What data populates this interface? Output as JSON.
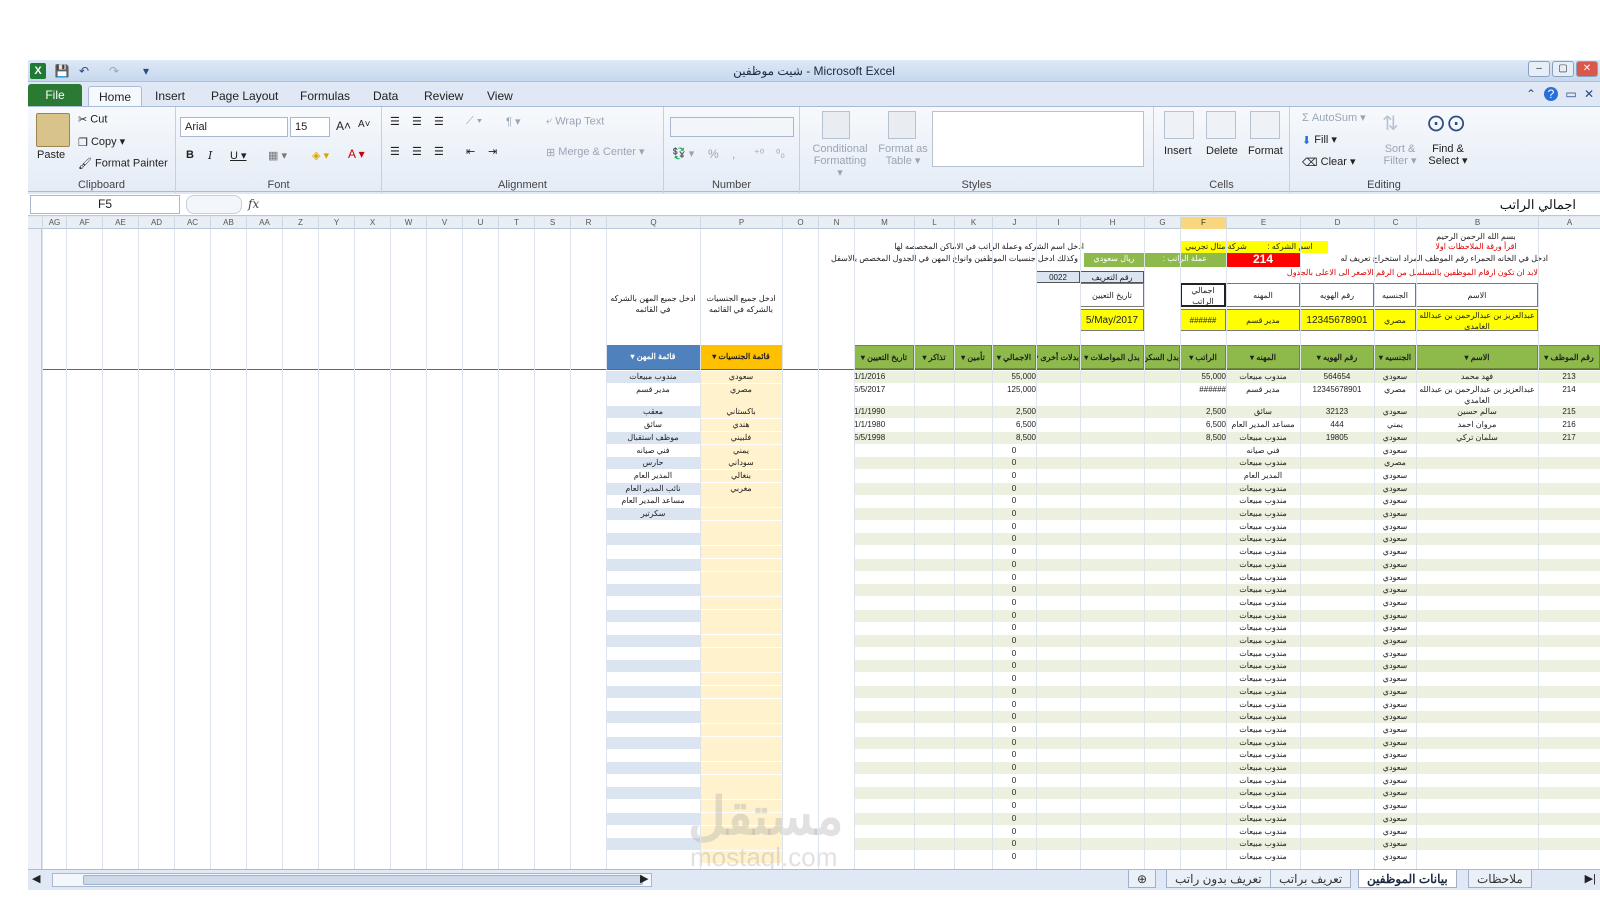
{
  "window": {
    "title": "شيت موظفين  -  Microsoft Excel"
  },
  "qat": {
    "save": "💾",
    "undo": "↶",
    "redo": "↷"
  },
  "tabs": [
    "File",
    "Home",
    "Insert",
    "Page Layout",
    "Formulas",
    "Data",
    "Review",
    "View"
  ],
  "clipboard": {
    "paste": "Paste",
    "cut": "Cut",
    "copy": "Copy ▾",
    "format_painter": "Format Painter",
    "label": "Clipboard"
  },
  "font": {
    "name": "Arial",
    "size": "15",
    "label": "Font"
  },
  "alignment": {
    "wrap": "Wrap Text",
    "merge": "Merge & Center ▾",
    "label": "Alignment"
  },
  "number": {
    "label": "Number",
    "percent": "%",
    "comma": ","
  },
  "styles": {
    "conditional": "Conditional Formatting ▾",
    "format_table": "Format as Table ▾",
    "label": "Styles"
  },
  "cells": {
    "insert": "Insert",
    "delete": "Delete",
    "format": "Format",
    "label": "Cells"
  },
  "editing": {
    "autosum": "Σ AutoSum ▾",
    "fill": "Fill ▾",
    "clear": "Clear ▾",
    "sort": "Sort & Filter ▾",
    "find": "Find & Select ▾",
    "label": "Editing"
  },
  "formula_bar": {
    "name_box": "F5",
    "fx": "fx",
    "content": "اجمالي الراتب"
  },
  "columns": [
    "AG",
    "AF",
    "AE",
    "AD",
    "AC",
    "AB",
    "AA",
    "Z",
    "Y",
    "X",
    "W",
    "V",
    "U",
    "T",
    "S",
    "R",
    "Q",
    "P",
    "O",
    "N",
    "M",
    "L",
    "K",
    "J",
    "I",
    "H",
    "G",
    "F",
    "E",
    "D",
    "C",
    "B",
    "A"
  ],
  "top": {
    "basmala": "بسم الله الرحمن الرحيم",
    "read_notes": "اقرأ ورقة الملاحظات اولا",
    "instr1": "ادخل في الخانه الحمراء رقم الموظف المراد استخراج تعريف له",
    "instr2": "لابد ان تكون ارقام الموظفين بالتسلسل من الرقم الاصغر الى الاعلى بالجدول",
    "company_label": "اسم الشركه :",
    "company_value": "شركة مثال تجريبي",
    "currency_label": "عملة الراتب :",
    "currency_value": "ريال سعودي",
    "emp_no": "214",
    "instr3": "ادخل اسم الشركه وعملة الراتب في الاماكن المخصصه لها",
    "instr4": "وكذلك ادخل جنسيات الموظفين وانواع المهن في  الجدول المخصص بالاسفل",
    "def_no_label": "رقم التعريف",
    "def_no_value": "0022",
    "hdr_name": "الاسم",
    "hdr_nat": "الجنسيه",
    "hdr_id": "رقم الهويه",
    "hdr_job": "المهنه",
    "hdr_total": "اجمالي الراتب",
    "hdr_date": "تاريخ التعيين",
    "val_name": "عبدالعزيز بن عبدالرحمن بن عبدالله الغامدي",
    "val_nat": "مصري",
    "val_id": "12345678901",
    "val_job": "مدير قسم",
    "val_total": "######",
    "val_date": "5/May/2017",
    "nat_note": "ادخل جميع الجنسيات بالشركه في القائمه",
    "job_note": "ادخل جميع المهن بالشركه في القائمه"
  },
  "table": {
    "headers": [
      "رقم الموظف",
      "الاسم",
      "الجنسيه",
      "رقم الهويه",
      "المهنه",
      "الراتب",
      "بدل السكن",
      "بدل المواصلات",
      "بدلات أخرى",
      "الاجمالي",
      "تأمين",
      "تذاكر",
      "تاريخ التعيين"
    ],
    "rows": [
      {
        "no": "213",
        "name": "فهد محمد",
        "nat": "سعودي",
        "id": "564654",
        "job": "مندوب مبيعات",
        "salary": "55,000",
        "total": "55,000",
        "date": "1/1/2016"
      },
      {
        "no": "214",
        "name": "عبدالعزيز بن عبدالرحمن بن عبدالله الغامدي",
        "nat": "مصري",
        "id": "12345678901",
        "job": "مدير قسم",
        "salary": "######",
        "total": "125,000",
        "date": "5/5/2017"
      },
      {
        "no": "215",
        "name": "سالم حسين",
        "nat": "سعودي",
        "id": "32123",
        "job": "سائق",
        "salary": "2,500",
        "total": "2,500",
        "date": "1/1/1990"
      },
      {
        "no": "216",
        "name": "مروان احمد",
        "nat": "يمني",
        "id": "444",
        "job": "مساعد المدير العام",
        "salary": "6,500",
        "total": "6,500",
        "date": "1/1/1980"
      },
      {
        "no": "217",
        "name": "سلمان تركي",
        "nat": "سعودي",
        "id": "19805",
        "job": "مندوب مبيعات",
        "salary": "8,500",
        "total": "8,500",
        "date": "5/5/1998"
      }
    ],
    "filler_nat": [
      "سعودي",
      "مصري",
      "سعودي",
      "سعودي",
      "سعودي"
    ],
    "filler_job": [
      "فني صيانه",
      "مندوب مبيعات",
      "المدير العام",
      "مندوب مبيعات",
      "مندوب مبيعات"
    ],
    "zero": "0"
  },
  "nationalities": {
    "header": "قائمة الجنسيات",
    "items": [
      "سعودي",
      "مصري",
      "باكستاني",
      "هندي",
      "فلبيني",
      "يمني",
      "سوداني",
      "بنغالي",
      "مغربي"
    ]
  },
  "professions": {
    "header": "قائمة المهن",
    "items": [
      "مندوب مبيعات",
      "مدير قسم",
      "معقب",
      "سائق",
      "موظف استقبال",
      "فني صيانه",
      "حارس",
      "المدير العام",
      "نائب المدير العام",
      "مساعد المدير العام",
      "سكرتير"
    ]
  },
  "sheets": [
    "ملاحظات",
    "بيانات الموظفين",
    "تعريف براتب",
    "تعريف بدون راتب"
  ],
  "active_sheet": "بيانات الموظفين",
  "watermark": {
    "ar": "مستقل",
    "en": "mostaql.com"
  },
  "colors": {
    "green": "#8dba4a",
    "yellow": "#ffff00",
    "red": "#ff0000",
    "orange": "#ffc000",
    "blue_hdr": "#4f81bd",
    "light_green": "#ebf1de",
    "light_blue": "#dbe5f1",
    "light_orange": "#fff2cc"
  }
}
